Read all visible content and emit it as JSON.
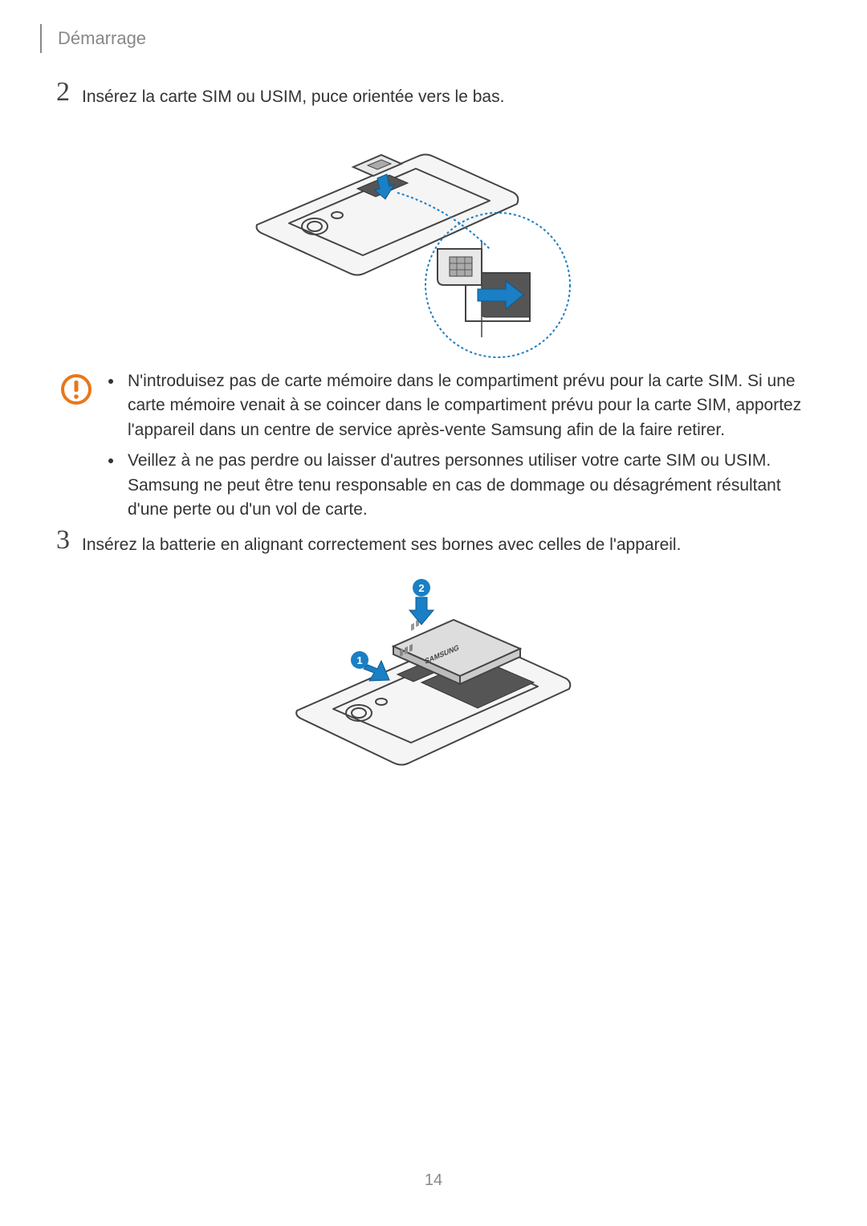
{
  "header": {
    "title": "Démarrage"
  },
  "step2": {
    "number": "2",
    "text": "Insérez la carte SIM ou USIM, puce orientée vers le bas."
  },
  "caution": {
    "bullets": [
      "N'introduisez pas de carte mémoire dans le compartiment prévu pour la carte SIM. Si une carte mémoire venait à se coincer dans le compartiment prévu pour la carte SIM, apportez l'appareil dans un centre de service après-vente Samsung afin de la faire retirer.",
      "Veillez à ne pas perdre ou laisser d'autres personnes utiliser votre carte SIM ou USIM. Samsung ne peut être tenu responsable en cas de dommage ou désagrément résultant d'une perte ou d'un vol de carte."
    ]
  },
  "step3": {
    "number": "3",
    "text": "Insérez la batterie en alignant correctement ses bornes avec celles de l'appareil."
  },
  "figure2": {
    "callout1": "1",
    "callout2": "2",
    "battery_label": "SAMSUNG"
  },
  "page_number": "14"
}
